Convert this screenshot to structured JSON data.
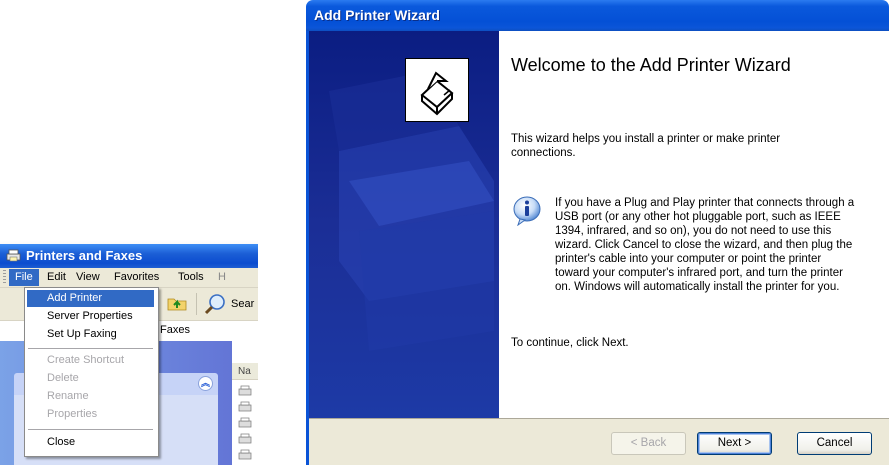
{
  "explorer": {
    "title": "Printers and Faxes",
    "menu": [
      "File",
      "Edit",
      "View",
      "Favorites",
      "Tools",
      "H"
    ],
    "toolbar": {
      "search_label": "Sear"
    },
    "address_text": "Faxes",
    "list_header": "Na"
  },
  "file_menu": {
    "items": [
      {
        "label": "Add Printer",
        "state": "highlighted"
      },
      {
        "label": "Server Properties",
        "state": "enabled"
      },
      {
        "label": "Set Up Faxing",
        "state": "enabled"
      },
      {
        "label": "Create Shortcut",
        "state": "disabled"
      },
      {
        "label": "Delete",
        "state": "disabled"
      },
      {
        "label": "Rename",
        "state": "disabled"
      },
      {
        "label": "Properties",
        "state": "disabled"
      },
      {
        "label": "Close",
        "state": "enabled"
      }
    ]
  },
  "wizard": {
    "title": "Add Printer Wizard",
    "heading": "Welcome to the Add Printer Wizard",
    "intro": "This wizard helps you install a printer or make printer connections.",
    "info": "If you have a Plug and Play printer that connects through a USB port (or any other hot pluggable port, such as IEEE 1394, infrared, and so on), you do not need to use this wizard. Click Cancel to close the wizard, and then plug the printer's cable into your computer or point the printer toward your computer's infrared port, and turn the printer on. Windows will automatically install the printer for you.",
    "continue": "To continue, click Next.",
    "buttons": {
      "back": "< Back",
      "next": "Next >",
      "cancel": "Cancel"
    }
  },
  "colors": {
    "xp_title_blue": "#0450d6",
    "menu_highlight": "#316ac5",
    "wizard_side": "#1b2e96"
  }
}
